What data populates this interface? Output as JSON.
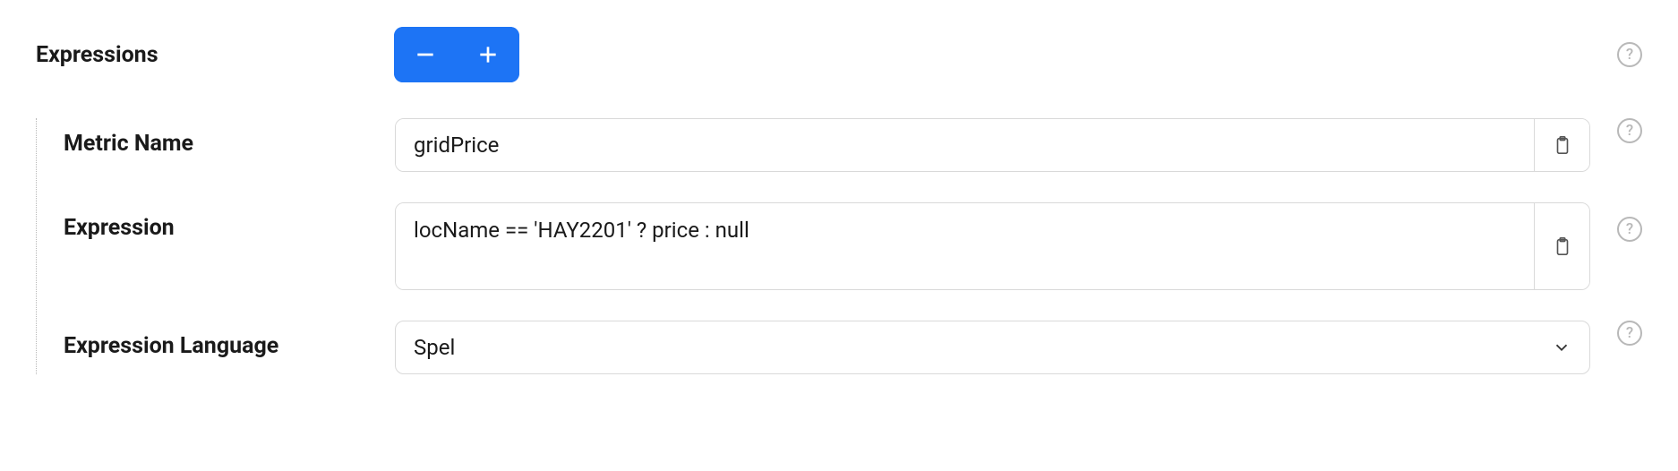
{
  "section": {
    "title": "Expressions"
  },
  "fields": {
    "metricName": {
      "label": "Metric Name",
      "value": "gridPrice"
    },
    "expression": {
      "label": "Expression",
      "value": "locName == 'HAY2201' ? price : null"
    },
    "expressionLanguage": {
      "label": "Expression Language",
      "value": "Spel"
    }
  }
}
